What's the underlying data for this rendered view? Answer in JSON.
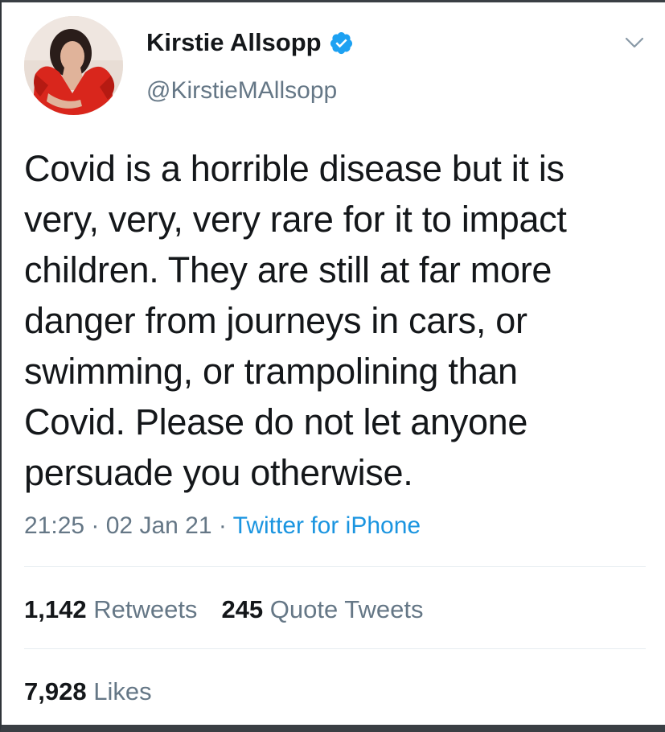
{
  "tweet": {
    "author": {
      "display_name": "Kirstie Allsopp",
      "handle": "@KirstieMAllsopp",
      "verified": true
    },
    "text": "Covid is a horrible disease but it is\nvery, very, very rare for it to impact\nchildren. They are still at far more\ndanger from journeys in cars, or\nswimming, or trampolining than\nCovid. Please do not let anyone\npersuade you otherwise.",
    "time": "21:25",
    "separator": " · ",
    "date": "02 Jan 21",
    "source": "Twitter for iPhone",
    "retweets": {
      "count": "1,142",
      "label": "Retweets"
    },
    "quote_tweets": {
      "count": "245",
      "label": "Quote Tweets"
    },
    "likes": {
      "count": "7,928",
      "label": "Likes"
    }
  },
  "icons": {
    "verified": "verified-badge-icon",
    "more": "chevron-down-icon"
  },
  "colors": {
    "text": "#14171a",
    "secondary": "#657786",
    "link": "#1b95e0",
    "verified": "#1da1f2",
    "divider": "#e6ecf0"
  }
}
